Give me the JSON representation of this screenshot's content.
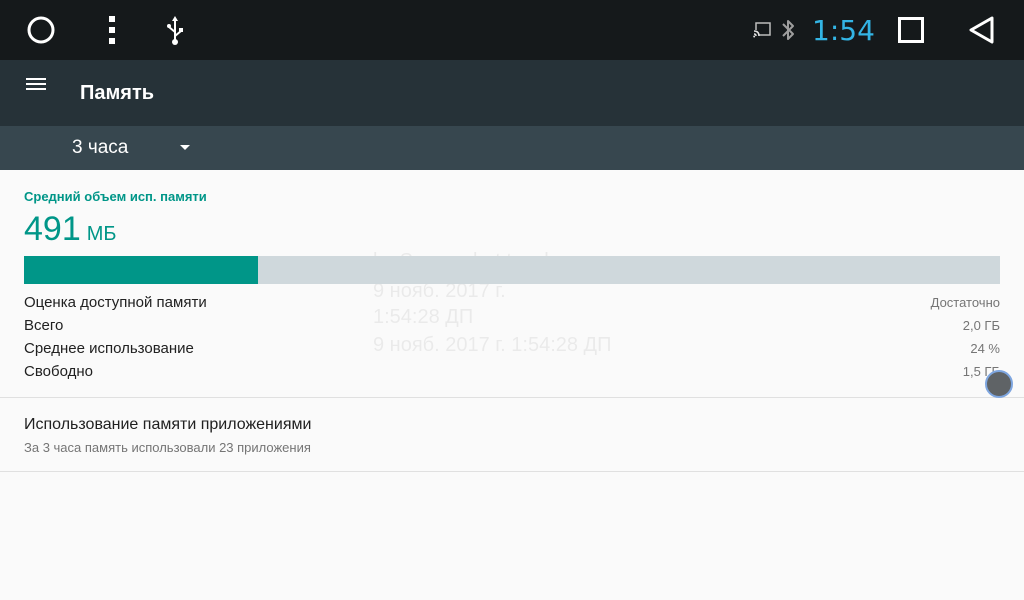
{
  "status_bar": {
    "time": "1:54",
    "icons": [
      "home-circle-icon",
      "overflow-menu-icon",
      "usb-icon",
      "cast-icon",
      "bluetooth-icon",
      "recents-square-icon",
      "back-triangle-icon"
    ]
  },
  "app_bar": {
    "title": "Память",
    "menu_icon": "hamburger-menu-icon"
  },
  "period_spinner": {
    "selected": "3 часа",
    "icon": "dropdown-arrow-icon"
  },
  "memory_summary": {
    "title": "Средний объем исп. памяти",
    "value": "491",
    "unit": "МБ",
    "usage_fraction": 0.24,
    "colors": {
      "accent": "#009688",
      "track": "#cfd8dc"
    }
  },
  "stats": [
    {
      "label": "Оценка доступной памяти",
      "value": "Достаточно"
    },
    {
      "label": "Всего",
      "value": "2,0 ГБ"
    },
    {
      "label": "Среднее использование",
      "value": "24 %"
    },
    {
      "label": "Свободно",
      "value": "1,5 ГБ"
    }
  ],
  "app_usage": {
    "title": "Использование памяти приложениями",
    "subtitle": "За 3 часа память использовали 23 приложения"
  },
  "watermark": {
    "line1": "by Screenshot touch",
    "line2": "9 нояб. 2017 г.",
    "line3": "1:54:28 ДП",
    "line4": "9 нояб. 2017 г. 1:54:28 ДП"
  }
}
